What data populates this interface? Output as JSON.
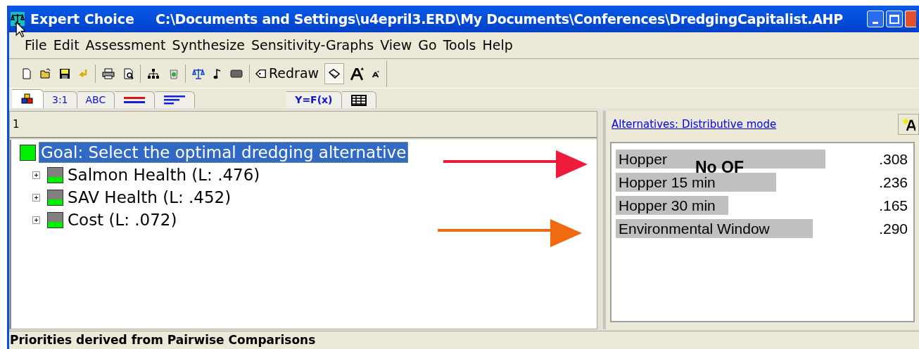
{
  "window": {
    "title": "Expert Choice",
    "path": "C:\\Documents and Settings\\u4epril3.ERD\\My Documents\\Conferences\\DredgingCapitalist.AHP"
  },
  "menu": [
    "File",
    "Edit",
    "Assessment",
    "Synthesize",
    "Sensitivity-Graphs",
    "View",
    "Go",
    "Tools",
    "Help"
  ],
  "toolbar": [
    {
      "kind": "icon",
      "pressed": false
    },
    {
      "kind": "icon",
      "pressed": false
    },
    {
      "kind": "icon",
      "pressed": false
    },
    {
      "kind": "icon",
      "pressed": false
    },
    {
      "kind": "sep"
    },
    {
      "kind": "icon",
      "pressed": false
    },
    {
      "kind": "icon",
      "pressed": false
    },
    {
      "kind": "sep"
    },
    {
      "kind": "icon",
      "pressed": false
    },
    {
      "kind": "icon",
      "pressed": false
    },
    {
      "kind": "sep"
    },
    {
      "kind": "icon",
      "pressed": false
    },
    {
      "kind": "icon",
      "pressed": false
    },
    {
      "kind": "icon",
      "pressed": false
    },
    {
      "kind": "sep"
    },
    {
      "kind": "text",
      "label": "Redraw",
      "pressed": false
    },
    {
      "kind": "icon",
      "pressed": true
    },
    {
      "kind": "icon",
      "pressed": false
    },
    {
      "kind": "icon",
      "pressed": false
    }
  ],
  "tabs": [
    {
      "kind": "icon",
      "selected": true
    },
    {
      "kind": "text",
      "label": "3:1",
      "selected": false
    },
    {
      "kind": "text",
      "label": "ABC",
      "selected": false
    },
    {
      "kind": "icon",
      "selected": false
    },
    {
      "kind": "icon",
      "selected": false
    },
    {
      "kind": "text",
      "label": "Y=F(x)",
      "selected": false
    },
    {
      "kind": "icon",
      "selected": false
    }
  ],
  "left_pane": {
    "header": "1",
    "tree": [
      {
        "label": "Goal: Select the optimal dredging alternative",
        "selected": true,
        "children": [
          {
            "label": "Salmon Health (L: .476)",
            "selected": false,
            "expanded": false
          },
          {
            "label": "SAV Health (L: .452)",
            "selected": false,
            "expanded": false
          },
          {
            "label": "Cost (L: .072)",
            "selected": false,
            "expanded": false
          }
        ]
      }
    ]
  },
  "right_pane": {
    "header_link": "Alternatives: Distributive mode",
    "alternatives": [
      {
        "name": "Hopper",
        "value": ".308"
      },
      {
        "name": "Hopper 15 min",
        "value": ".236"
      },
      {
        "name": "Hopper 30 min",
        "value": ".165"
      },
      {
        "name": "Environmental Window",
        "value": ".290"
      }
    ]
  },
  "annotations": [
    {
      "kind": "label",
      "text": "No OF"
    },
    {
      "kind": "arrow",
      "color": "#ee1c3a"
    },
    {
      "kind": "arrow",
      "color": "#f26a10"
    }
  ],
  "status_bar": "Priorities derived from Pairwise Comparisons"
}
